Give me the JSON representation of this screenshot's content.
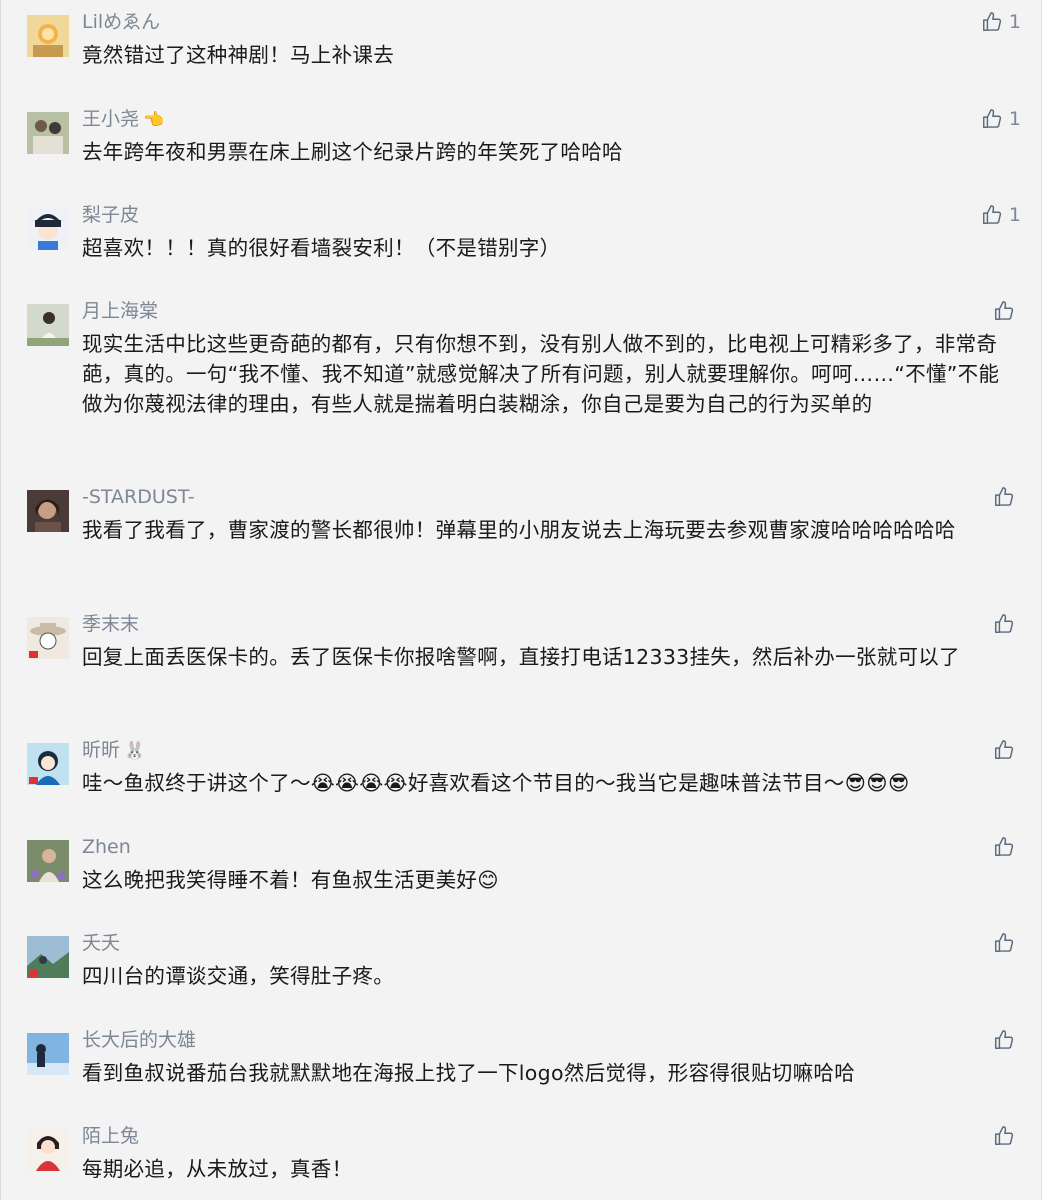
{
  "comments": [
    {
      "name": "Lilめゑん",
      "text": "竟然错过了这种神剧！马上补课去",
      "likes": "1",
      "avatar": "avatar-sun-character-icon",
      "avatar_bg": "#e9c97a"
    },
    {
      "name": "王小尧",
      "name_emoji": "👈",
      "text": "去年跨年夜和男票在床上刷这个纪录片跨的年笑死了哈哈哈",
      "likes": "1",
      "avatar": "avatar-couple-photo-icon",
      "avatar_bg": "#b9c2a8"
    },
    {
      "name": "梨子皮",
      "text": "超喜欢！！！真的很好看墙裂安利！（不是错别字）",
      "likes": "1",
      "avatar": "avatar-cartoon-boy-icon",
      "avatar_bg": "#e8eef5"
    },
    {
      "name": "月上海棠",
      "text": "现实生活中比这些更奇葩的都有，只有你想不到，没有别人做不到的，比电视上可精彩多了，非常奇葩，真的。一句“我不懂、我不知道”就感觉解决了所有问题，别人就要理解你。呵呵……“不懂”不能做为你蔑视法律的理由，有些人就是揣着明白装糊涂，你自己是要为自己的行为买单的",
      "likes": "",
      "avatar": "avatar-girl-sitting-icon",
      "avatar_bg": "#cfd6c6"
    },
    {
      "name": "-STARDUST-",
      "text": "我看了我看了，曹家渡的警长都很帅！弹幕里的小朋友说去上海玩要去参观曹家渡哈哈哈哈哈哈",
      "likes": "",
      "avatar": "avatar-dark-portrait-icon",
      "avatar_bg": "#5b4a44"
    },
    {
      "name": "季末末",
      "text": "回复上面丢医保卡的。丢了医保卡你报啥警啊，直接打电话12333挂失，然后补办一张就可以了",
      "likes": "",
      "avatar": "avatar-hat-sketch-icon",
      "avatar_bg": "#eee8df"
    },
    {
      "name": "昕昕",
      "name_emoji": "🐰",
      "text": "哇～鱼叔终于讲这个了～😭😭😭😭好喜欢看这个节目的～我当它是趣味普法节目～😎😎😎",
      "likes": "",
      "avatar": "avatar-cartoon-girl-icon",
      "avatar_bg": "#bfe0ef"
    },
    {
      "name": "Zhen",
      "text": "这么晚把我笑得睡不着！有鱼叔生活更美好😊",
      "likes": "",
      "avatar": "avatar-woman-flowers-icon",
      "avatar_bg": "#7a8a6a"
    },
    {
      "name": "夭夭",
      "text": "四川台的谭谈交通，笑得肚子疼。",
      "likes": "",
      "avatar": "avatar-landscape-icon",
      "avatar_bg": "#8fb0c8"
    },
    {
      "name": "长大后的大雄",
      "text": "看到鱼叔说番茄台我就默默地在海报上找了一下logo然后觉得，形容得很贴切嘛哈哈",
      "likes": "",
      "avatar": "avatar-silhouette-sky-icon",
      "avatar_bg": "#6fa8d6"
    },
    {
      "name": "陌上兔",
      "text": "每期必追，从未放过，真香！",
      "likes": "",
      "avatar": "avatar-doll-icon",
      "avatar_bg": "#f4eee8"
    }
  ],
  "colors": {
    "name": "#7d8796",
    "text": "#1a1a1a",
    "background": "#f3f3f3"
  }
}
